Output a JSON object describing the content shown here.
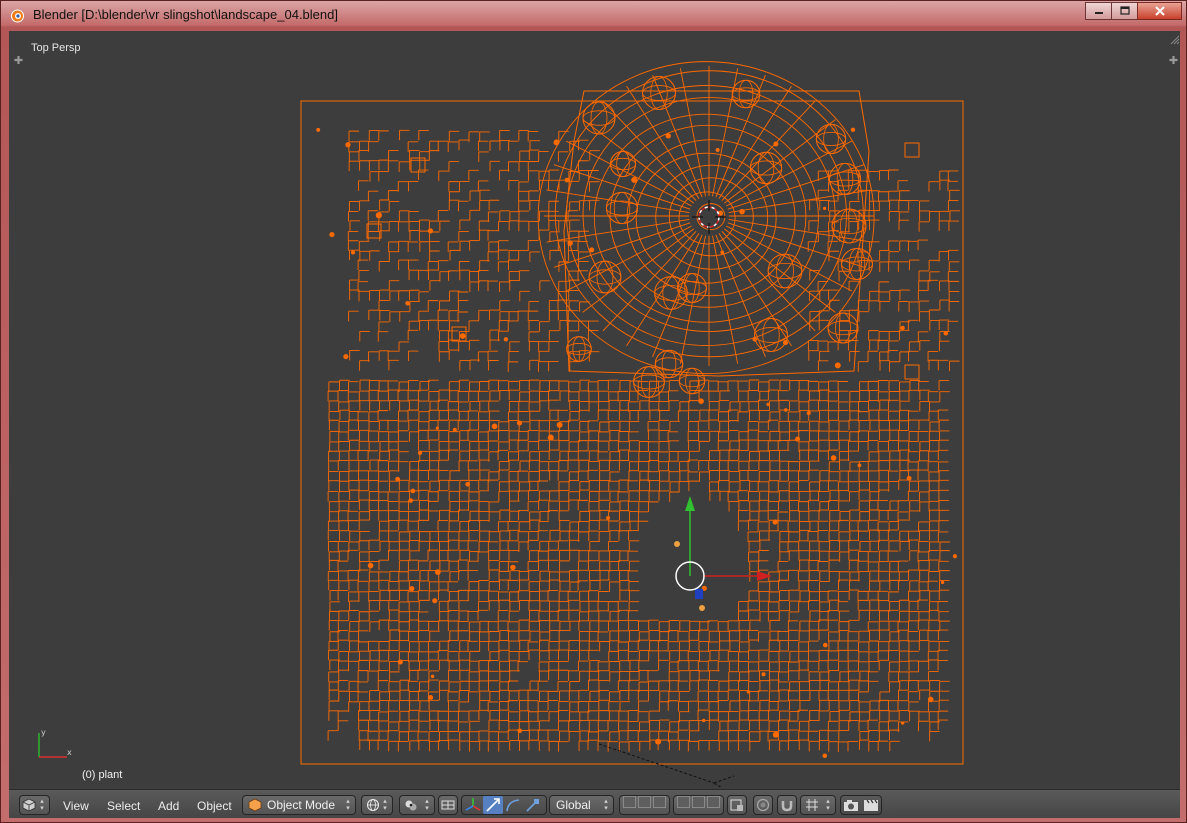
{
  "window": {
    "title": "Blender [D:\\blender\\vr slingshot\\landscape_04.blend]",
    "minimize_icon": "minimize-icon",
    "maximize_icon": "maximize-icon",
    "close_icon": "close-icon"
  },
  "viewport": {
    "view_name": "Top Persp",
    "object_info": "(0) plant",
    "wire_color": "#ff6a00",
    "background_color": "#3d3d3d"
  },
  "header": {
    "menus": [
      "View",
      "Select",
      "Add",
      "Object"
    ],
    "mode": "Object Mode",
    "orientation": "Global",
    "editor_type_icon": "cube-icon",
    "viewport_shading_icon": "sphere-icon",
    "pivot_icon": "pivot-icon",
    "manipulator_icons": [
      "manipulator-toggle-icon",
      "translate-icon",
      "rotate-icon",
      "scale-icon"
    ],
    "snap_icon": "magnet-icon",
    "render_icons": [
      "camera-icon",
      "clapperboard-icon"
    ]
  }
}
